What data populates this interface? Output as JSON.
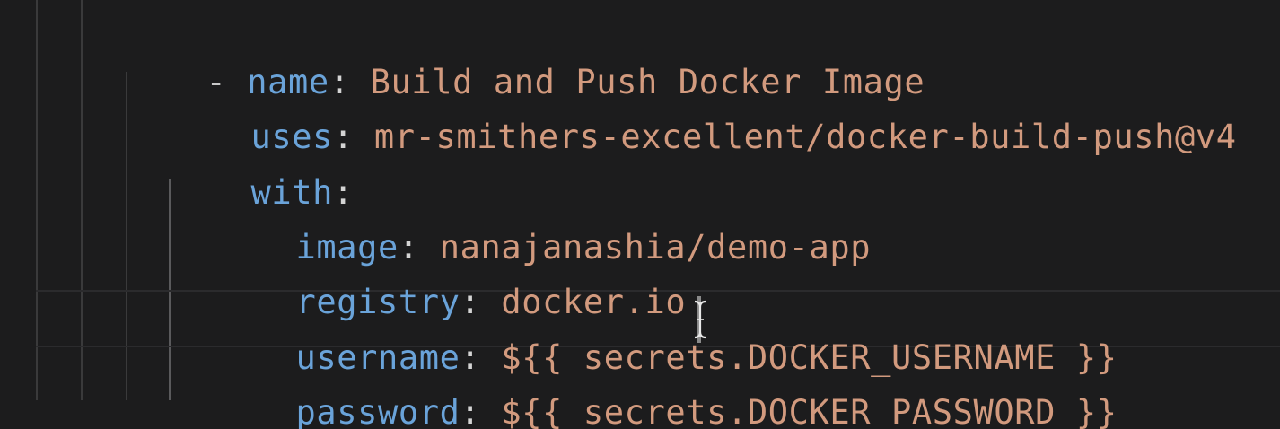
{
  "code": {
    "lines": [
      {
        "dash": "-",
        "key": "name",
        "colon": ":",
        "value": "Build and Push Docker Image"
      },
      {
        "key": "uses",
        "colon": ":",
        "value": "mr-smithers-excellent/docker-build-push@v4"
      },
      {
        "key": "with",
        "colon": ":",
        "value": ""
      },
      {
        "key": "image",
        "colon": ":",
        "value": "nanajanashia/demo-app"
      },
      {
        "key": "registry",
        "colon": ":",
        "value": "docker.io"
      },
      {
        "key": "username",
        "colon": ":",
        "value": "${{ secrets.DOCKER_USERNAME }}"
      },
      {
        "key": "password",
        "colon": ":",
        "value": "${{ secrets.DOCKER_PASSWORD }}"
      }
    ]
  },
  "colors": {
    "background": "#1c1c1d",
    "key": "#6aa3d9",
    "value": "#d29a7e",
    "punctuation": "#d4d4d4"
  }
}
